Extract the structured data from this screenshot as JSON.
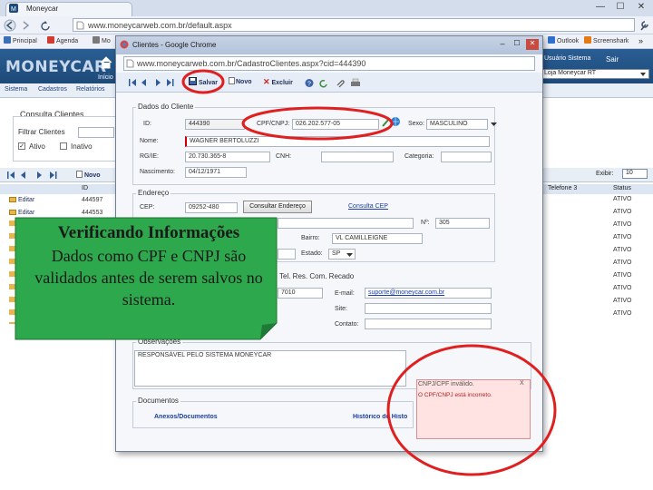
{
  "browser": {
    "tab_title": "Moneycar",
    "url": "www.moneycarweb.com.br/default.aspx",
    "win_min": "—",
    "win_max": "☐",
    "win_close": "✕",
    "bookmarks": [
      "Principal",
      "Agenda",
      "Mo"
    ],
    "bm_right": [
      "Outlook",
      "Screenshark"
    ],
    "bm_right_colors": [
      "#2f6fd0",
      "#e27a17"
    ],
    "bm_colors": [
      "#3b6fb6",
      "#d23b2f",
      "#7a7a7a"
    ]
  },
  "app": {
    "logo": "MONEYCAR",
    "inicio": "Início",
    "menu": [
      "Sistema",
      "Cadastros",
      "Relatórios"
    ],
    "user": "Usuário Sistema",
    "sair": "Sair",
    "company_select": "Loja Moneycar RT"
  },
  "left_panel": {
    "title": "Consulta Clientes",
    "filter_label": "Filtrar Clientes",
    "ativo_label": "Ativo",
    "inativo_label": "Inativo",
    "novo": "Novo",
    "id_header": "ID",
    "rows": [
      {
        "action": "Editar",
        "id": "444597"
      },
      {
        "action": "Editar",
        "id": "444553"
      }
    ]
  },
  "right_panel": {
    "col_header": "Telefone 3",
    "status_header": "Status",
    "exibir_label": "Exibir:",
    "exibir_value": "10",
    "status_values": [
      "ATIVO",
      "ATIVO",
      "ATIVO",
      "ATIVO",
      "ATIVO",
      "ATIVO",
      "ATIVO",
      "ATIVO",
      "ATIVO",
      "ATIVO"
    ]
  },
  "popup": {
    "title": "Clientes - Google Chrome",
    "url": "www.moneycarweb.com.br/CadastroClientes.aspx?cid=444390",
    "toolbar": {
      "salvar": "Salvar",
      "novo": "Novo",
      "excluir": "Excluir"
    },
    "dados": {
      "section": "Dados do Cliente",
      "id_label": "ID:",
      "id_value": "444390",
      "cpf_label": "CPF/CNPJ:",
      "cpf_value": "026.202.577-05",
      "sexo_label": "Sexo:",
      "sexo_value": "MASCULINO",
      "nome_label": "Nome:",
      "nome_value": "WAGNER BERTOLUZZI",
      "rg_label": "RG/IE:",
      "rg_value": "20.730.365-8",
      "cnh_label": "CNH:",
      "categoria_label": "Categoria:",
      "nasc_label": "Nascimento:",
      "nasc_value": "04/12/1971"
    },
    "endereco": {
      "section": "Endereço",
      "cep_label": "CEP:",
      "cep_value": "09252-480",
      "consultar_btn": "Consultar Endereço",
      "consulta_link": "Consulta CEP",
      "num_label": "Nº:",
      "num_value": "305",
      "bairro_label": "Bairro:",
      "bairro_value": "VL CAMILLEIGNE",
      "estado_label": "Estado:",
      "estado_value": "SP"
    },
    "contato": {
      "section": "Tel. Res. Com. Recado",
      "tel_value": "7010",
      "email_label": "E-mail:",
      "email_value": "suporte@moneycar.com.br",
      "site_label": "Site:",
      "contato_label": "Contato:"
    },
    "obs": {
      "section": "Observações",
      "text": "RESPONSÁVEL PELO SISTEMA MONEYCAR"
    },
    "footer": {
      "section": "Documentos",
      "anexos_link": "Anexos/Documentos",
      "historico_link": "Histórico do Histo"
    },
    "error": {
      "head": "CNPJ/CPF inválido.",
      "close": "X",
      "message": "O CPF/CNPJ está incorreto."
    }
  },
  "annotation": {
    "title": "Verificando Informações",
    "body": "Dados como CPF e CNPJ são validados antes de serem salvos no sistema."
  }
}
